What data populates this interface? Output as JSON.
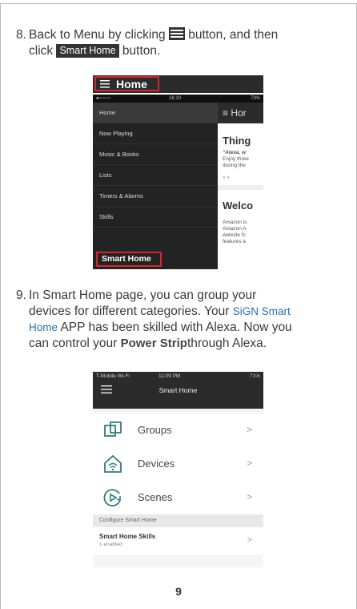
{
  "step8": {
    "number": "8.",
    "line1_a": "Back to Menu by clicking",
    "line1_b": "button, and then",
    "line2_a": "click",
    "inline_button": "Smart Home",
    "line2_b": "button."
  },
  "shot1": {
    "home_label": "Home",
    "status_time": "16:10",
    "status_right": "73%",
    "menu_items": [
      "Home",
      "Now Playing",
      "Music & Books",
      "Lists",
      "Timers & Alarms",
      "Skills"
    ],
    "smart_home": "Smart Home",
    "right_header": "Hor",
    "right_title": "Thing",
    "right_quote": "\"Alexa, w",
    "right_line1": "Enjoy three",
    "right_line2": "during the",
    "right_welcome": "Welco",
    "right_p1": "Amazon is",
    "right_p2": "Amazon A",
    "right_p3": "website fc",
    "right_p4": "features a"
  },
  "step9": {
    "number": "9.",
    "line1": "In Smart Home page, you can group your",
    "line2_a": "devices for different categories. Your",
    "brand_a": "SiGN Smart",
    "brand_b": "Home",
    "line3_b": "APP has been skilled with Alexa. Now you",
    "line4_a": "can control your",
    "product": "Power Strip",
    "line4_b": "through Alexa."
  },
  "shot2": {
    "status_left": "T-Mobile Wi-Fi",
    "status_time": "11:09 PM",
    "status_right": "71%",
    "title": "Smart Home",
    "rows": [
      "Groups",
      "Devices",
      "Scenes"
    ],
    "chevron": ">",
    "config_header": "Configure Smart Home",
    "skills_title": "Smart Home Skills",
    "skills_sub": "1 enabled"
  },
  "page_number": "9"
}
